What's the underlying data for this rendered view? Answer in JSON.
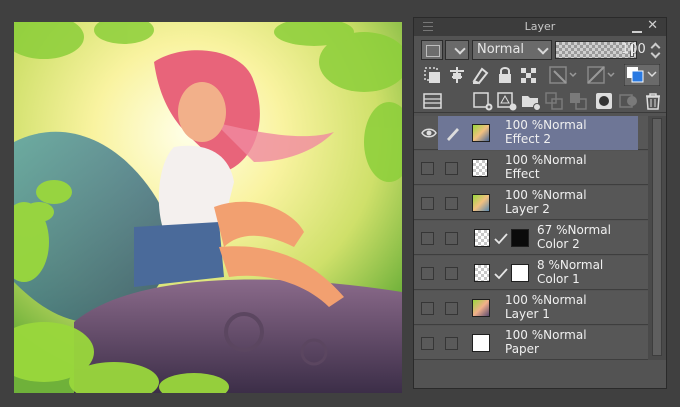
{
  "panel": {
    "title": "Layer",
    "blend_mode": "Normal",
    "opacity": "100"
  },
  "toolbar": {
    "row1_icons": [
      "layer-color-swatch-icon",
      "blend-mode-dropdown",
      "opacity-slider",
      "opacity-spinner"
    ],
    "row2_icons": [
      "clip-to-layer-below-icon",
      "set-as-reference-layer-icon",
      "set-draft-layer-icon",
      "lock-layer-icon",
      "lock-transparent-pixels-icon",
      "enable-mask-icon",
      "mask-display-icon",
      "layer-color-icon"
    ],
    "row3_icons": [
      "layer-menu-icon",
      "new-raster-layer-icon",
      "new-vector-layer-icon",
      "new-folder-icon",
      "transfer-to-lower-layer-icon",
      "combine-with-layer-below-icon",
      "create-layer-mask-icon",
      "apply-mask-icon",
      "delete-layer-icon"
    ]
  },
  "layers": [
    {
      "opacity_mode": "100 %Normal",
      "name": "Effect 2",
      "selected": true,
      "visible": true
    },
    {
      "opacity_mode": "100 %Normal",
      "name": "Effect",
      "selected": false
    },
    {
      "opacity_mode": "100 %Normal",
      "name": "Layer 2",
      "selected": false
    },
    {
      "opacity_mode": "67 %Normal",
      "name": "Color 2",
      "selected": false,
      "mask": "black"
    },
    {
      "opacity_mode": "8 %Normal",
      "name": "Color 1",
      "selected": false,
      "mask": "white"
    },
    {
      "opacity_mode": "100 %Normal",
      "name": "Layer 1",
      "selected": false
    },
    {
      "opacity_mode": "100 %Normal",
      "name": "Paper",
      "selected": false
    }
  ],
  "colors": {
    "selected_row": "#6e7696",
    "panel_bg": "#535353",
    "title_bg": "#3c3c3c",
    "layer_color_blue": "#2a7ae2"
  }
}
